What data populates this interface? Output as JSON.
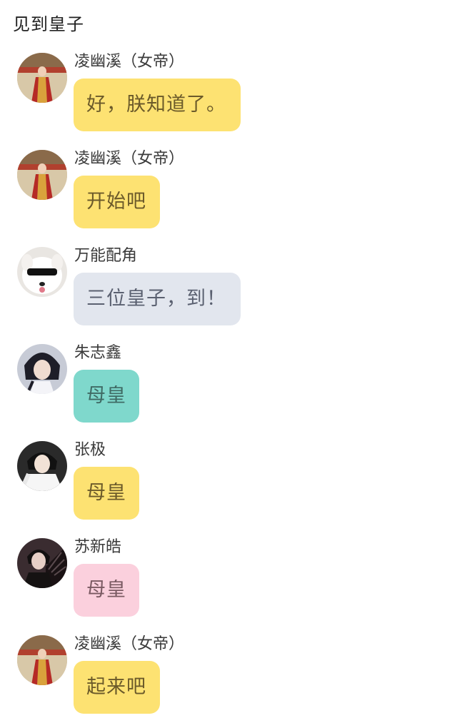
{
  "chat_title": "见到皇子",
  "colors": {
    "yellow": "#fde272",
    "gray": "#e2e6ee",
    "teal": "#7fd8cc",
    "pink": "#fbd0dd"
  },
  "messages": [
    {
      "avatar": "empress-avatar",
      "name": "凌幽溪（女帝）",
      "text": "好，朕知道了。",
      "bubble_color": "#fde272"
    },
    {
      "avatar": "empress-avatar",
      "name": "凌幽溪（女帝）",
      "text": "开始吧",
      "bubble_color": "#fde272"
    },
    {
      "avatar": "dog-avatar",
      "name": "万能配角",
      "text": "三位皇子，到！",
      "bubble_color": "#e2e6ee"
    },
    {
      "avatar": "prince-avatar",
      "name": "朱志鑫",
      "text": "母皇",
      "bubble_color": "#7fd8cc"
    },
    {
      "avatar": "prince-white-avatar",
      "name": "张极",
      "text": "母皇",
      "bubble_color": "#fde272"
    },
    {
      "avatar": "prince-dark-avatar",
      "name": "苏新皓",
      "text": "母皇",
      "bubble_color": "#fbd0dd"
    },
    {
      "avatar": "empress-avatar",
      "name": "凌幽溪（女帝）",
      "text": "起来吧",
      "bubble_color": "#fde272"
    }
  ]
}
